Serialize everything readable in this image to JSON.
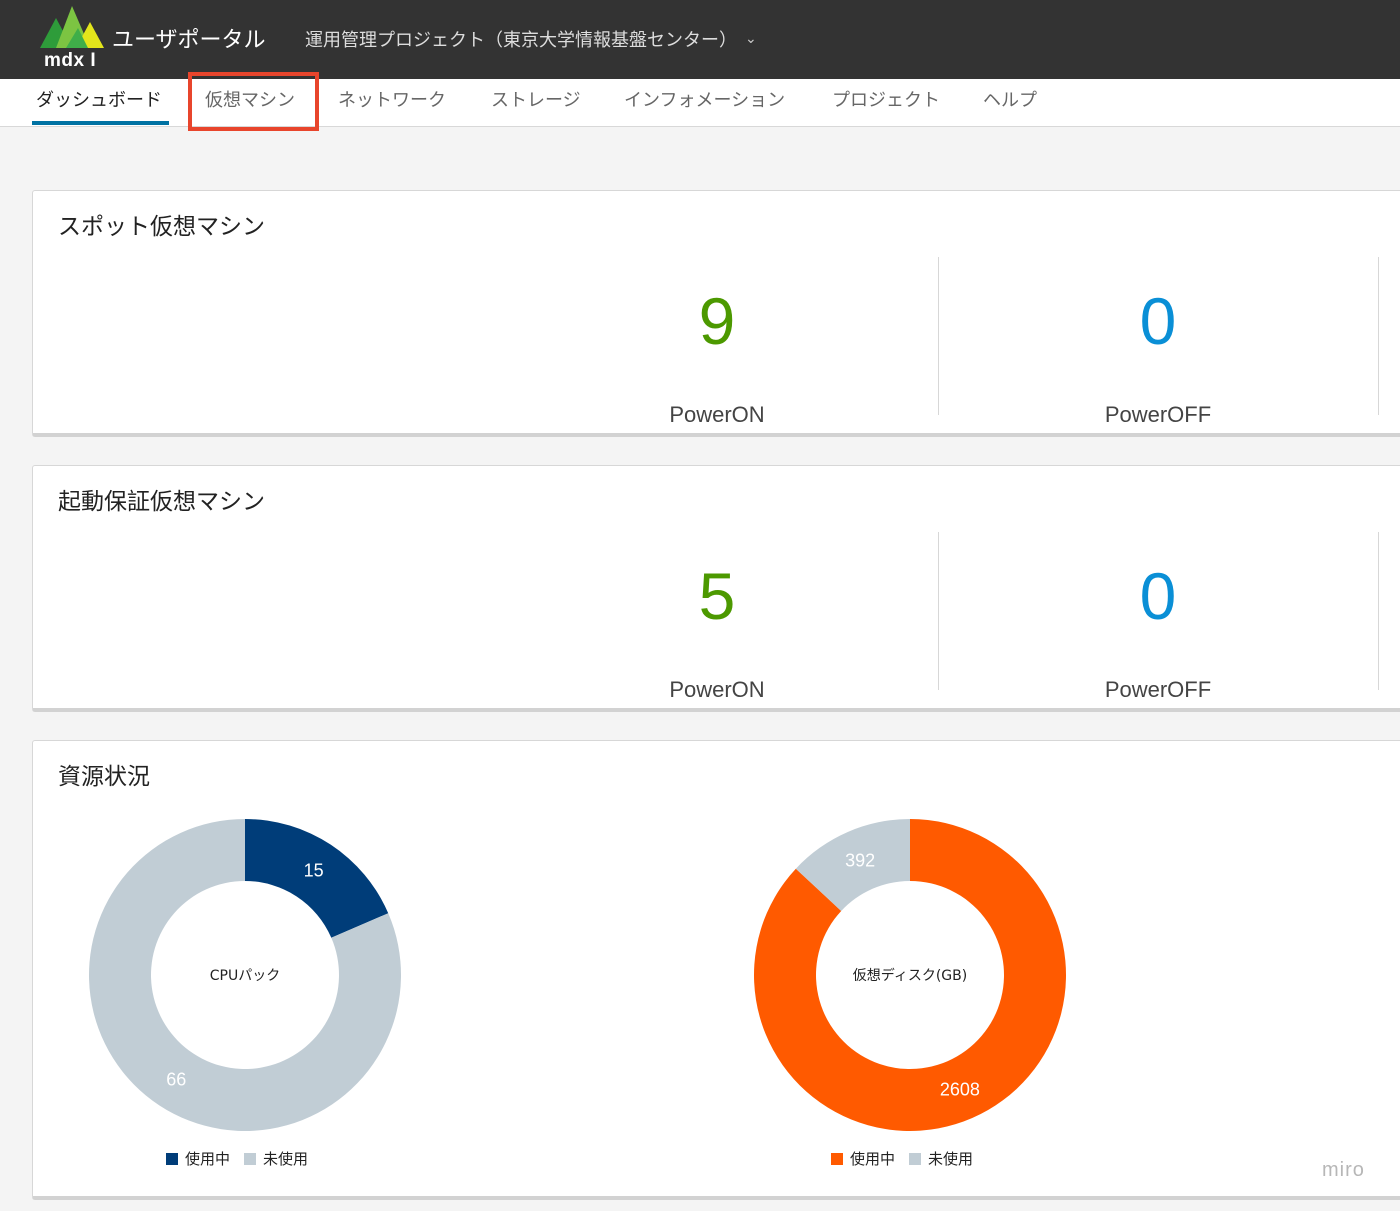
{
  "header": {
    "logo_text": "mdx I",
    "app_title": "ユーザポータル",
    "project_name": "運用管理プロジェクト（東京大学情報基盤センター）",
    "project_chevron": "⌄"
  },
  "nav": {
    "items": [
      {
        "label": "ダッシュボード",
        "active": true
      },
      {
        "label": "仮想マシン",
        "highlighted": true
      },
      {
        "label": "ネットワーク"
      },
      {
        "label": "ストレージ"
      },
      {
        "label": "インフォメーション"
      },
      {
        "label": "プロジェクト"
      },
      {
        "label": "ヘルプ"
      }
    ]
  },
  "spot_vm": {
    "title": "スポット仮想マシン",
    "power_on_count": "9",
    "power_on_label": "PowerON",
    "power_off_count": "0",
    "power_off_label": "PowerOFF"
  },
  "guaranteed_vm": {
    "title": "起動保証仮想マシン",
    "power_on_count": "5",
    "power_on_label": "PowerON",
    "power_off_count": "0",
    "power_off_label": "PowerOFF"
  },
  "resources": {
    "title": "資源状況",
    "legend_used": "使用中",
    "legend_unused": "未使用"
  },
  "chart_data": [
    {
      "type": "pie",
      "title": "CPUパック",
      "categories": [
        "使用中",
        "未使用"
      ],
      "values": [
        15,
        66
      ],
      "colors": [
        "#003d79",
        "#c1cdd5"
      ]
    },
    {
      "type": "pie",
      "title": "仮想ディスク(GB)",
      "categories": [
        "使用中",
        "未使用"
      ],
      "values": [
        2608,
        392
      ],
      "colors": [
        "#ff5a00",
        "#c1cdd5"
      ]
    }
  ],
  "colors": {
    "header_bg": "#333333",
    "active_tab": "#0072a3",
    "highlight": "#e8452c",
    "power_on": "#4c9900",
    "power_off": "#0a8fd6"
  },
  "watermark": "miro"
}
